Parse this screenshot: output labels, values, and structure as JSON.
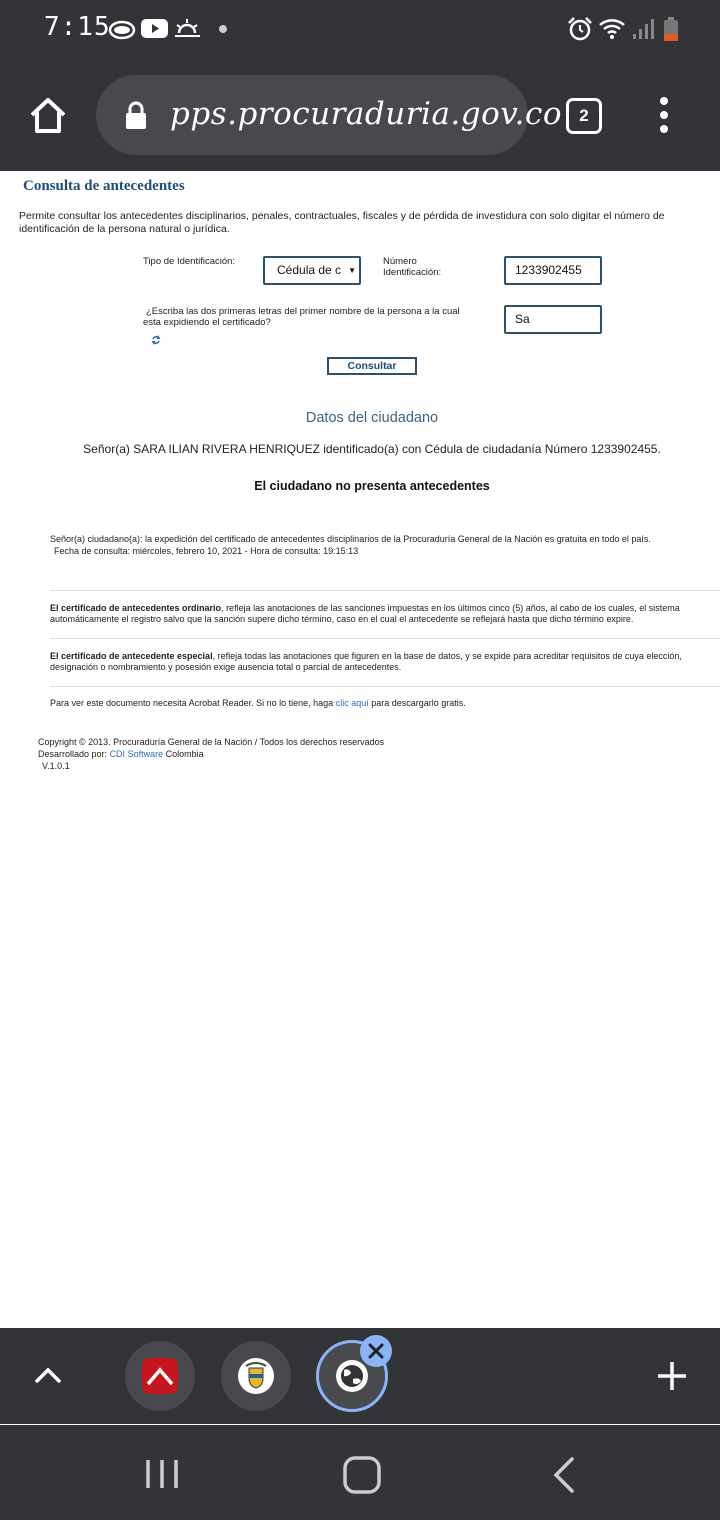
{
  "status_bar": {
    "time": "7:15"
  },
  "browser": {
    "url": "pps.procuraduria.gov.co",
    "tab_count": "2"
  },
  "page": {
    "title": "Consulta de antecedentes",
    "description": "Permite consultar los antecedentes disciplinarios, penales, contractuales, fiscales y de pérdida de investidura con solo digitar el número de identificación de la persona natural o jurídica.",
    "form": {
      "id_type_label": "Tipo de Identificación:",
      "id_type_value": "Cédula de c",
      "id_number_label_1": "Número",
      "id_number_label_2": "Identificación:",
      "id_number_value": "1233902455",
      "question_line1": "¿Escriba las dos primeras letras del primer nombre de la persona a la cual",
      "question_line2": "esta expidiendo el certificado?",
      "answer_value": "Sa",
      "submit_label": "Consultar"
    },
    "result": {
      "heading": "Datos del ciudadano",
      "citizen_text": "Señor(a)  SARA ILIAN RIVERA HENRIQUEZ identificado(a) con Cédula de ciudadanía Número 1233902455.",
      "status": "El ciudadano no presenta antecedentes"
    },
    "notice_line1": "Señor(a) ciudadano(a): la expedición del certificado de antecedentes disciplinarios de la Procuraduría General de la Nación es gratuita en todo el país.",
    "notice_line2": "Fecha de consulta: miércoles, febrero 10, 2021 - Hora de consulta: 19:15:13",
    "ordinary_bold": "El certificado de antecedentes ordinario",
    "ordinary_rest1": ", refleja las anotaciones de las sanciones impuestas en los últimos cinco (5) años, al cabo de los cuales, el sistema",
    "ordinary_rest2": "automáticamente el registro salvo que la sanción supere dicho término, caso en el cual el antecedente se reflejará hasta que dicho término expire.",
    "special_bold": "El certificado de antecedente especial",
    "special_rest1": ", refleja todas las anotaciones que figuren en la base de datos, y se expide para acreditar requisitos de cuya elección,",
    "special_rest2": "designación o nombramiento y posesión exige ausencia total o parcial de antecedentes.",
    "acrobat_pre": "Para ver este documento necesita Acrobat Reader. Si no lo tiene, haga",
    "acrobat_link": "clic aquí",
    "acrobat_post": "para descargarlo gratis.",
    "footer_copyright": "Copyright © 2013. Procuraduría General de la Nación / Todos los derechos reservados",
    "footer_dev_pre": "Desarrollado por:",
    "footer_dev_link": "CDI Software",
    "footer_dev_post": "Colombia",
    "footer_version": "V.1.0.1"
  },
  "colors": {
    "chrome": "#333437",
    "heading": "#1d4e7a",
    "link": "#2a71c7",
    "tab_active": "#8ab4f8"
  },
  "icons": [
    "home-icon",
    "lock-icon",
    "tab-switcher-icon",
    "more-menu-icon",
    "refresh-captcha-icon",
    "chevron-up-icon",
    "app-tab-icon",
    "coat-of-arms-tab-icon",
    "globe-tab-icon",
    "close-icon",
    "plus-icon",
    "recents-icon",
    "home-nav-icon",
    "back-icon"
  ]
}
